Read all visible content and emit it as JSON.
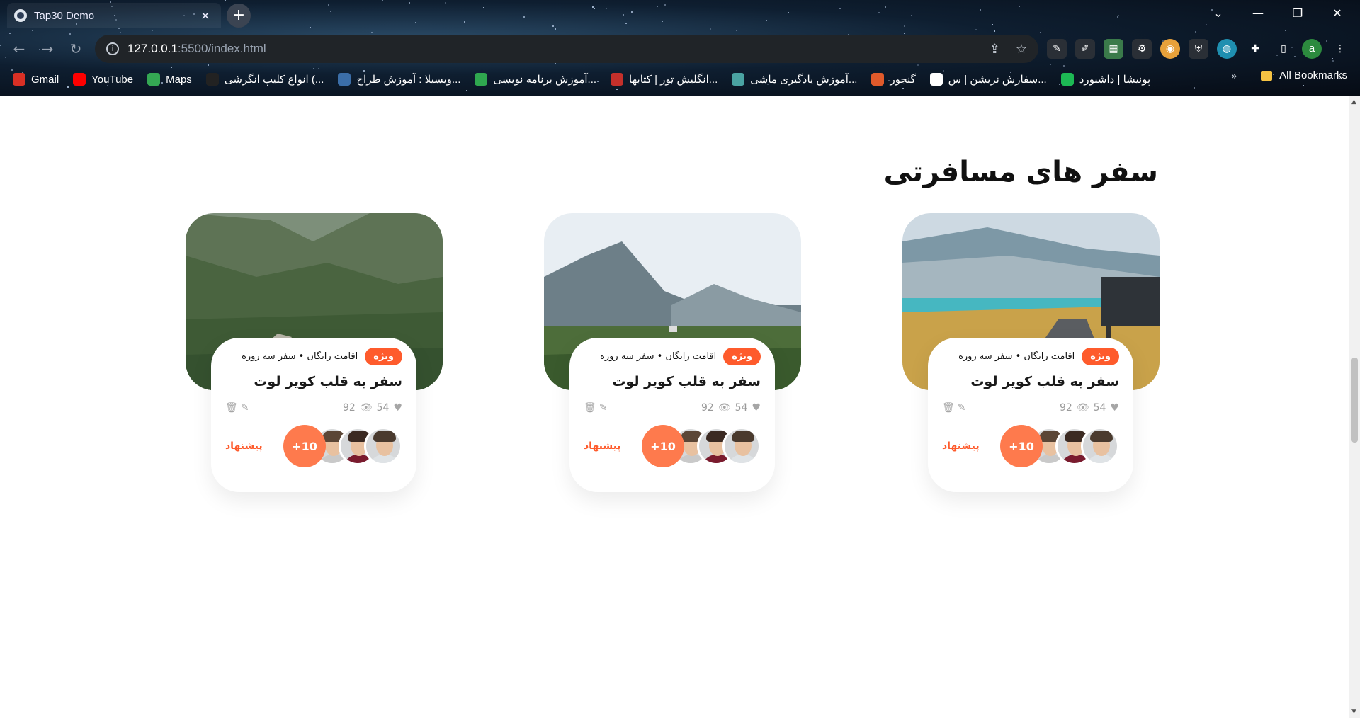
{
  "browser": {
    "tab_title": "Tap30 Demo",
    "tab_close": "✕",
    "new_tab": "+",
    "url_host": "127.0.0.1",
    "url_path": ":5500/index.html",
    "window_controls": {
      "dropdown": "⌄",
      "minimize": "—",
      "restore": "❐",
      "close": "✕"
    },
    "nav": {
      "back": "←",
      "forward": "→",
      "reload": "↻"
    },
    "profile_initial": "a",
    "bookmarks": [
      {
        "label": "Gmail",
        "icon": "gmail-icon",
        "color": "#d93025"
      },
      {
        "label": "YouTube",
        "icon": "youtube-icon",
        "color": "#ff0000"
      },
      {
        "label": "Maps",
        "icon": "maps-icon",
        "color": "#34a853"
      },
      {
        "label": "انواع کلیپ انگرشی (...",
        "icon": "clip-icon",
        "color": "#222222"
      },
      {
        "label": "ویسیلا : آموزش طراح...",
        "icon": "design-icon",
        "color": "#3b6ea8"
      },
      {
        "label": "آموزش برنامه نویسی...",
        "icon": "check-icon",
        "color": "#2fa84f"
      },
      {
        "label": "انگلیش تور | کتابها...",
        "icon": "book-icon",
        "color": "#c4302b"
      },
      {
        "label": "آموزش یادگیری ماشی...",
        "icon": "ml-icon",
        "color": "#4aa3a2"
      },
      {
        "label": "گنجور",
        "icon": "ganjoor-icon",
        "color": "#e05a2b"
      },
      {
        "label": "سفارش نریشن | س...",
        "icon": "narration-icon",
        "color": "#ffffff"
      },
      {
        "label": "پونیشا | داشبورد",
        "icon": "ponisha-icon",
        "color": "#1db954"
      }
    ],
    "bookmarks_more": "»",
    "all_bookmarks": "All Bookmarks"
  },
  "section": {
    "title": "سفر های مسافرتی"
  },
  "cards": [
    {
      "badge": "ویژه",
      "meta": "اقامت رایگان • سفر سه روزه",
      "title": "سفر به قلب کویر لوت",
      "likes": "54",
      "views": "92",
      "plus": "+10",
      "offer": "پیشنهاد",
      "image": "lake-road"
    },
    {
      "badge": "ویژه",
      "meta": "اقامت رایگان • سفر سه روزه",
      "title": "سفر به قلب کویر لوت",
      "likes": "54",
      "views": "92",
      "plus": "+10",
      "offer": "پیشنهاد",
      "image": "mountain-valley"
    },
    {
      "badge": "ویژه",
      "meta": "اقامت رایگان • سفر سه روزه",
      "title": "سفر به قلب کویر لوت",
      "likes": "54",
      "views": "92",
      "plus": "+10",
      "offer": "پیشنهاد",
      "image": "green-highlands"
    }
  ],
  "colors": {
    "accent": "#fe5b2c",
    "accent_light": "#fe7a4d"
  },
  "icons": {
    "heart": "♥",
    "eye": "👁",
    "trash": "🗑",
    "edit": "✎"
  }
}
